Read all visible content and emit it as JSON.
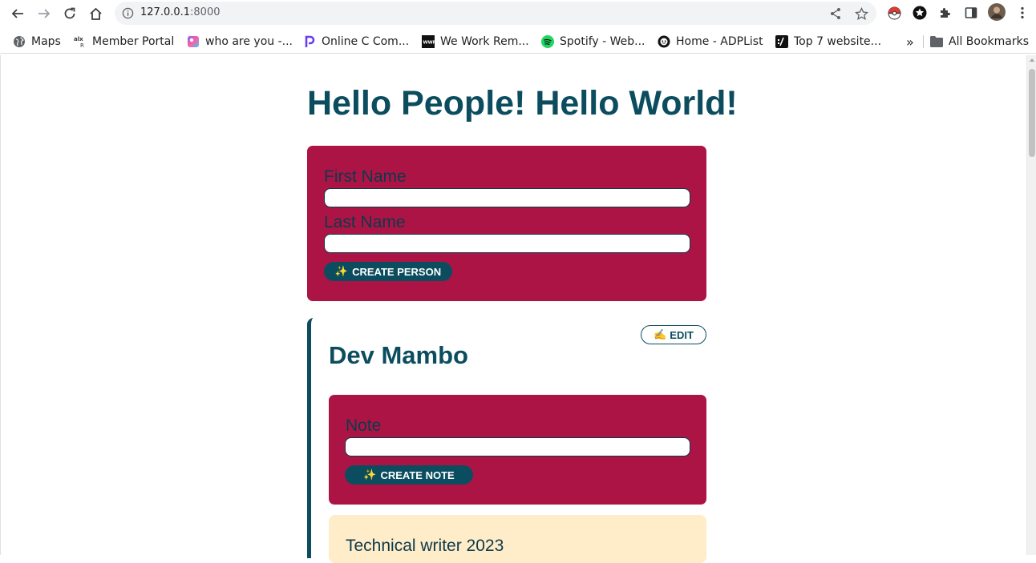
{
  "browser": {
    "url_host": "127.0.0.1",
    "url_port": ":8000",
    "bookmarks": [
      {
        "label": "Maps",
        "icon": "globe-icon"
      },
      {
        "label": "Member Portal",
        "icon": "alx-icon"
      },
      {
        "label": "who are you -...",
        "icon": "gradient-shape-icon"
      },
      {
        "label": "Online C Com...",
        "icon": "replit-p-icon"
      },
      {
        "label": "We Work Rem...",
        "icon": "wwr-icon"
      },
      {
        "label": "Spotify - Web...",
        "icon": "spotify-icon"
      },
      {
        "label": "Home - ADPList",
        "icon": "adplist-icon"
      },
      {
        "label": "Top 7 website...",
        "icon": "slash-logo-icon"
      }
    ],
    "overflow_label": "»",
    "all_bookmarks_label": "All Bookmarks"
  },
  "page": {
    "title": "Hello People! Hello World!",
    "person_form": {
      "first_name_label": "First Name",
      "last_name_label": "Last Name",
      "submit_emoji": "✨",
      "submit_label": "CREATE PERSON"
    },
    "person": {
      "name": "Dev Mambo",
      "edit_emoji": "✍️",
      "edit_label": "EDIT",
      "note_form": {
        "note_label": "Note",
        "submit_emoji": "✨",
        "submit_label": "CREATE NOTE"
      },
      "notes": [
        "Technical writer 2023"
      ]
    }
  },
  "colors": {
    "primary": "#0b4d5e",
    "form_background": "#ad1446",
    "note_background": "#ffecc9"
  }
}
